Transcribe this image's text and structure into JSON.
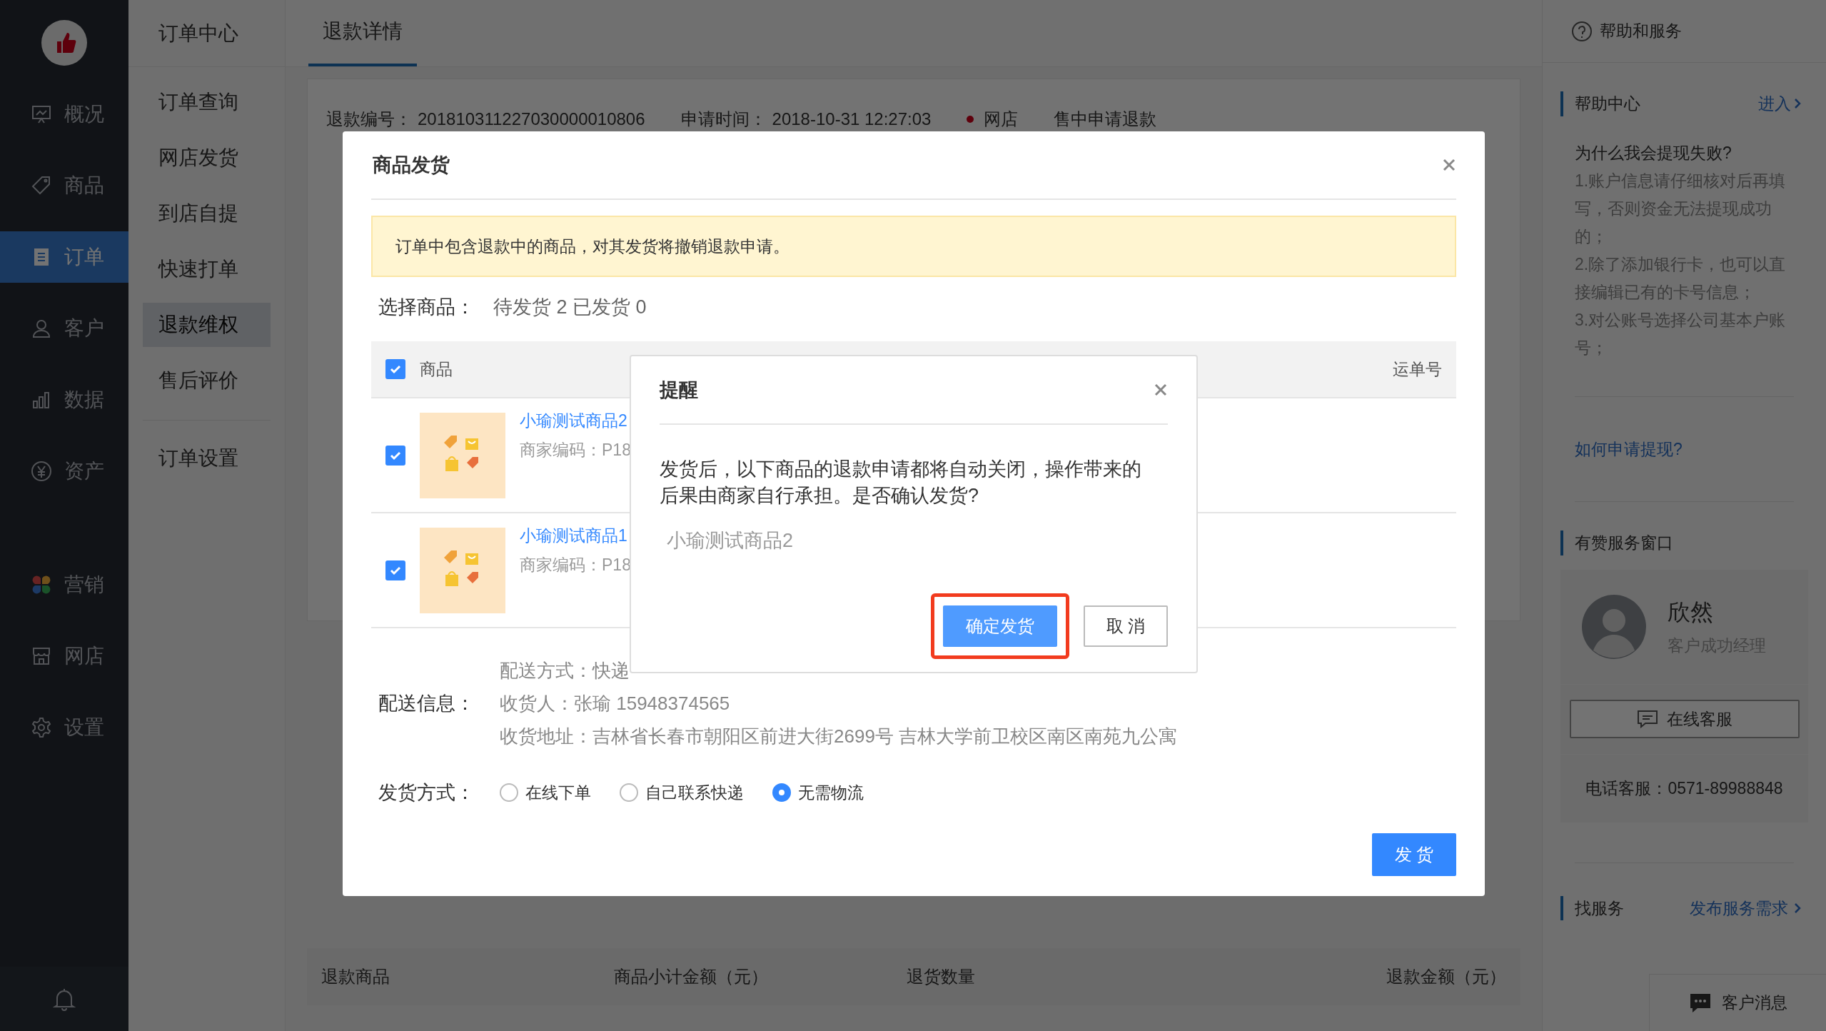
{
  "sidebar": {
    "groups": [
      [
        {
          "label": "概况",
          "selected": false
        },
        {
          "label": "商品",
          "selected": false
        },
        {
          "label": "订单",
          "selected": true
        },
        {
          "label": "客户",
          "selected": false
        },
        {
          "label": "数据",
          "selected": false
        },
        {
          "label": "资产",
          "selected": false
        }
      ],
      [
        {
          "label": "营销",
          "selected": false
        },
        {
          "label": "网店",
          "selected": false
        },
        {
          "label": "设置",
          "selected": false
        }
      ]
    ]
  },
  "subnav": {
    "title": "订单中心",
    "items": [
      {
        "label": "订单查询",
        "selected": false
      },
      {
        "label": "网店发货",
        "selected": false
      },
      {
        "label": "到店自提",
        "selected": false
      },
      {
        "label": "快速打单",
        "selected": false
      },
      {
        "label": "退款维权",
        "selected": true
      },
      {
        "label": "售后评价",
        "selected": false
      }
    ],
    "footer_items": [
      {
        "label": "订单设置",
        "selected": false
      }
    ]
  },
  "main": {
    "tab": {
      "label": "退款详情",
      "selected": true
    },
    "info": {
      "refund_no_label": "退款编号：",
      "refund_no": "201810311227030000010806",
      "time_label": "申请时间：",
      "time": "2018-10-31 12:27:03",
      "channel": "网店",
      "status": "售中申请退款"
    },
    "table_columns": [
      "退款商品",
      "商品小计金额（元）",
      "退货数量",
      "退款金额（元）"
    ]
  },
  "help": {
    "title": "帮助和服务",
    "help_center": {
      "title": "帮助中心",
      "link": "进入"
    },
    "question": "为什么我会提现失败?",
    "answers": [
      "1.账户信息请仔细核对后再填写，否则资金无法提现成功的；",
      "2.除了添加银行卡，也可以直接编辑已有的卡号信息；",
      "3.对公账号选择公司基本户账号；"
    ],
    "how_link": "如何申请提现?",
    "service": {
      "title": "有赞服务窗口",
      "name": "欣然",
      "role": "客户成功经理",
      "online_button": "在线客服",
      "phone": "电话客服：0571-89988848"
    },
    "find": {
      "title": "找服务",
      "link": "发布服务需求"
    },
    "messages_button": "客户消息"
  },
  "dialog": {
    "title": "商品发货",
    "notice": "订单中包含退款中的商品，对其发货将撤销退款申请。",
    "select_label": "选择商品：",
    "select_value": "待发货 2 已发货 0",
    "columns": [
      "商品",
      "运单号"
    ],
    "all_checked": true,
    "rows": [
      {
        "name": "小瑜测试商品2",
        "code": "商家编码：P18",
        "checked": true
      },
      {
        "name": "小瑜测试商品1",
        "code": "商家编码：P18",
        "checked": true
      }
    ],
    "delivery_label": "配送信息：",
    "delivery_lines": [
      "配送方式：快递",
      "收货人：张瑜 15948374565",
      "收货地址：吉林省长春市朝阳区前进大街2699号 吉林大学前卫校区南区南苑九公寓"
    ],
    "method_label": "发货方式：",
    "methods": [
      {
        "label": "在线下单",
        "selected": false
      },
      {
        "label": "自己联系快递",
        "selected": false
      },
      {
        "label": "无需物流",
        "selected": true
      }
    ],
    "ship_button": "发 货"
  },
  "alert": {
    "title": "提醒",
    "message": "发货后，以下商品的退款申请都将自动关闭，操作带来的后果由商家自行承担。是否确认发货?",
    "product": "小瑜测试商品2",
    "confirm": "确定发货",
    "cancel": "取 消",
    "confirm_highlighted": true
  }
}
